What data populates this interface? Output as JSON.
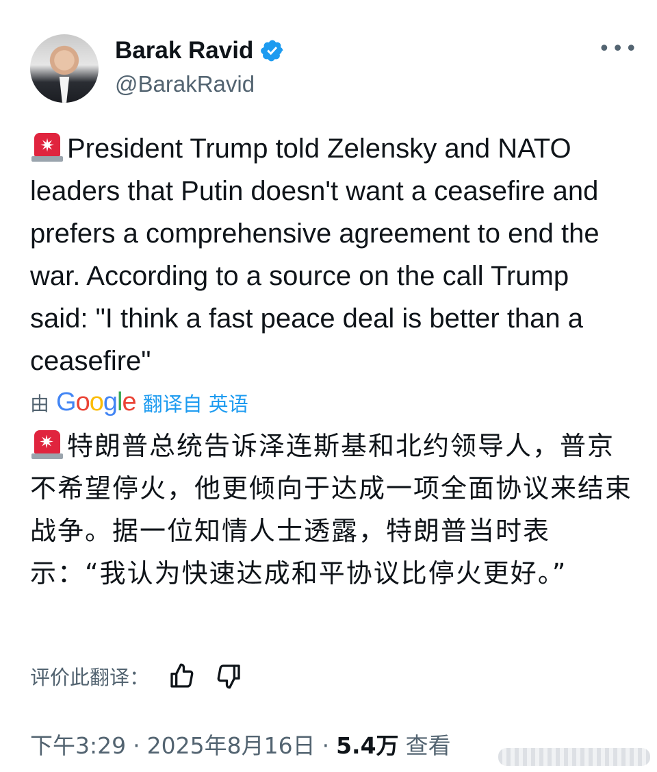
{
  "author": {
    "display_name": "Barak Ravid",
    "handle": "@BarakRavid"
  },
  "tweet": {
    "text": "President Trump told Zelensky and NATO leaders that Putin doesn't want a ceasefire and prefers a comprehensive agreement to end the war. According to a source on the call Trump said: \"I think a fast peace deal is better than a ceasefire\""
  },
  "translation": {
    "by": "由",
    "provider": "Google",
    "link_label": "翻译自 英语",
    "text": "特朗普总统告诉泽连斯基和北约领导人，普京不希望停火，他更倾向于达成一项全面协议来结束战争。据一位知情人士透露，特朗普当时表示：“我认为快速达成和平协议比停火更好。”",
    "rate_label": "评价此翻译："
  },
  "meta": {
    "time": "下午3:29",
    "date": "2025年8月16日",
    "views_count": "5.4万",
    "views_label": "查看"
  },
  "colors": {
    "accent": "#1d9bf0",
    "secondary_text": "#536471",
    "siren": "#e0243e"
  }
}
